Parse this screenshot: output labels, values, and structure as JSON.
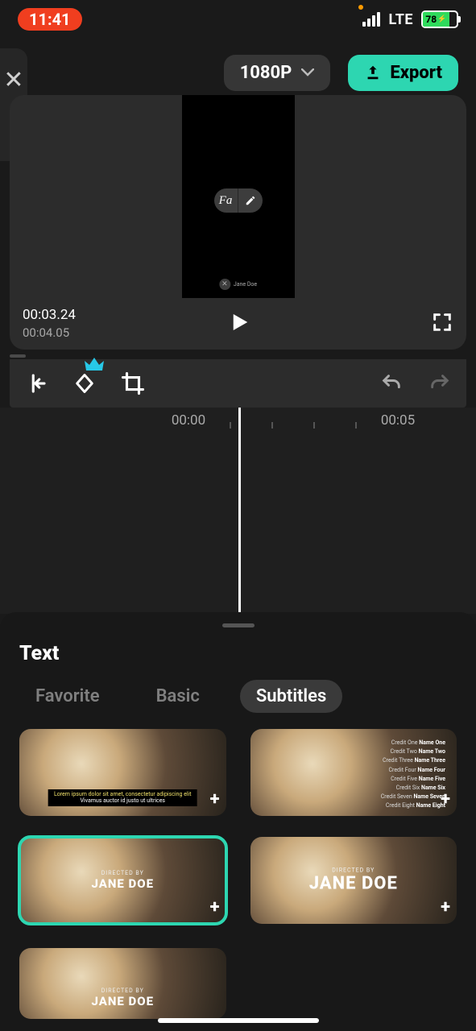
{
  "status": {
    "time": "11:41",
    "network": "LTE",
    "battery_pct": "78"
  },
  "top": {
    "resolution": "1080P",
    "export_label": "Export"
  },
  "preview": {
    "current_time": "00:03.24",
    "total_time": "00:04.05",
    "font_icon_label": "Fa",
    "annotation_text": "Jane Doe"
  },
  "timeline": {
    "start_label": "00:00",
    "end_label": "00:05"
  },
  "sheet": {
    "title": "Text",
    "tabs": {
      "favorite": "Favorite",
      "basic": "Basic",
      "subtitles": "Subtitles",
      "active": "subtitles"
    },
    "templates": [
      {
        "id": "lorem-subtitle",
        "style": "lorem",
        "lorem_line1": "Lorem ipsum dolor sit amet, consectetur adipiscing elit",
        "lorem_line2": "Vivamus auctor id justo ut ultrices"
      },
      {
        "id": "credits-roll",
        "style": "credits",
        "credits": [
          {
            "role": "Credit One",
            "name": "Name One"
          },
          {
            "role": "Credit Two",
            "name": "Name Two"
          },
          {
            "role": "Credit Three",
            "name": "Name Three"
          },
          {
            "role": "Credit Four",
            "name": "Name Four"
          },
          {
            "role": "Credit Five",
            "name": "Name Five"
          },
          {
            "role": "Credit Six",
            "name": "Name Six"
          },
          {
            "role": "Credit Seven",
            "name": "Name Seven"
          },
          {
            "role": "Credit Eight",
            "name": "Name Eight"
          }
        ]
      },
      {
        "id": "directed-small",
        "style": "directed",
        "sub": "DIRECTED BY",
        "main": "JANE DOE",
        "selected": true
      },
      {
        "id": "directed-big",
        "style": "directed-big",
        "sub": "DIRECTED BY",
        "main": "JANE DOE"
      },
      {
        "id": "directed-alt",
        "style": "directed",
        "sub": "DIRECTED BY",
        "main": "JANE DOE",
        "half": true
      }
    ]
  }
}
